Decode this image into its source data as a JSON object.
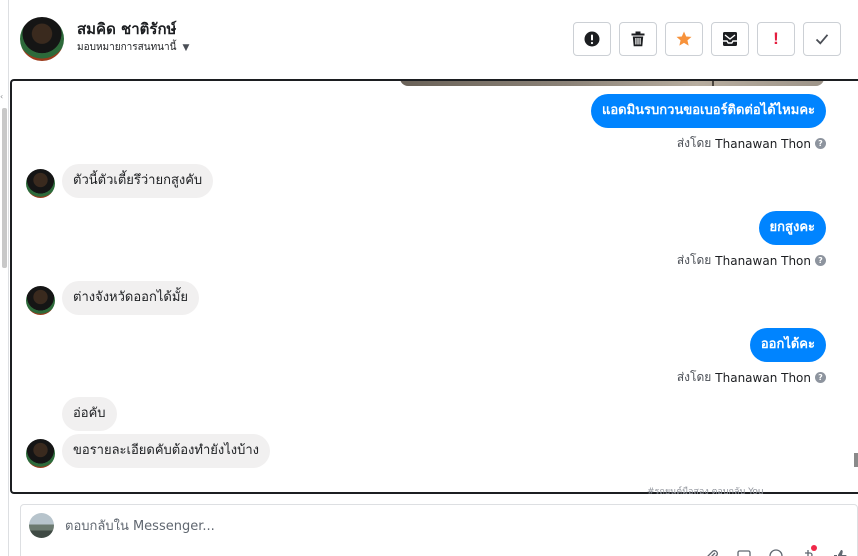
{
  "header": {
    "contact_name": "สมคิด ชาติรักษ์",
    "assign_label": "มอบหมายการสนทนานี้"
  },
  "actions": [
    {
      "name": "report-button",
      "icon": "exclamation-circle-icon"
    },
    {
      "name": "delete-button",
      "icon": "trash-icon"
    },
    {
      "name": "star-button",
      "icon": "star-icon",
      "color": "#f7923b"
    },
    {
      "name": "archive-button",
      "icon": "archive-mail-icon"
    },
    {
      "name": "spam-button",
      "icon": "exclamation-mark-icon",
      "color": "#e41e3f"
    },
    {
      "name": "done-button",
      "icon": "checkmark-icon"
    }
  ],
  "messages": {
    "out_1": "แอดมินรบกวนขอเบอร์ติดต่อได้ไหมคะ",
    "in_1": "ตัวนี้ตัวเตี้ยรึว่ายกสูงคับ",
    "out_2": "ยกสูงคะ",
    "in_2": "ต่างจังหวัดออกได้มั้ย",
    "out_3": "ออกได้คะ",
    "in_3": "อ่อคับ",
    "in_4": "ขอรายละเอียดคับต้องทำยังไงบ้าง"
  },
  "sent_by": {
    "prefix": "ส่งโดย",
    "agent": "Thanawan Thon"
  },
  "footnote": "#รถยนต์มือสอง ตอบกลับ You",
  "reply": {
    "placeholder": "ตอบกลับใน Messenger..."
  },
  "colors": {
    "outgoing_bubble": "#0084ff",
    "incoming_bubble": "#f1f0f0"
  }
}
